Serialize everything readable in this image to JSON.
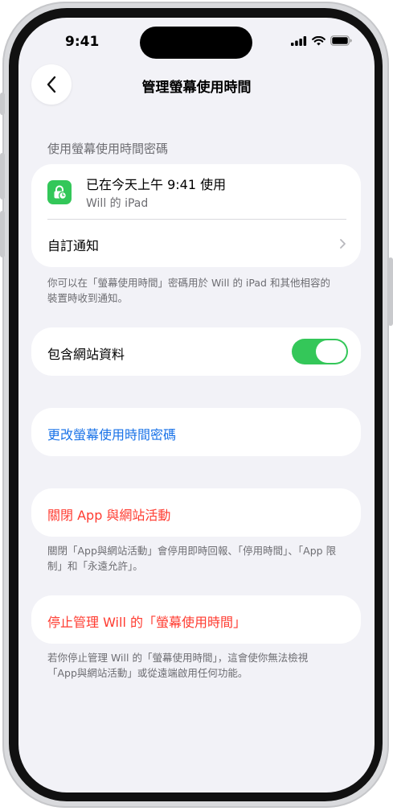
{
  "status": {
    "time": "9:41"
  },
  "nav": {
    "title": "管理螢幕使用時間"
  },
  "passcode_section": {
    "header": "使用螢幕使用時間密碼",
    "used_title": "已在今天上午 9:41 使用",
    "used_device": "Will 的 iPad",
    "custom_notify": "自訂通知",
    "footnote": "你可以在「螢幕使用時間」密碼用於 Will 的 iPad 和其他相容的裝置時收到通知。"
  },
  "website_data": {
    "label": "包含網站資料",
    "enabled": true
  },
  "change_passcode": {
    "label": "更改螢幕使用時間密碼"
  },
  "turn_off": {
    "label": "關閉 App 與網站活動",
    "footnote": "關閉「App與網站活動」會停用即時回報、「停用時間」、「App 限制」和「永遠允許」。"
  },
  "stop_manage": {
    "label": "停止管理 Will 的「螢幕使用時間」",
    "footnote": "若你停止管理 Will 的「螢幕使用時間」，這會使你無法檢視「App與網站活動」或從遠端啟用任何功能。"
  },
  "colors": {
    "accent": "#1a73e8",
    "destructive": "#ff3b30",
    "toggle_on": "#34c759"
  },
  "icons": [
    "back-chevron-icon",
    "lock-clock-icon",
    "chevron-right-icon",
    "signal-icon",
    "wifi-icon",
    "battery-icon"
  ]
}
